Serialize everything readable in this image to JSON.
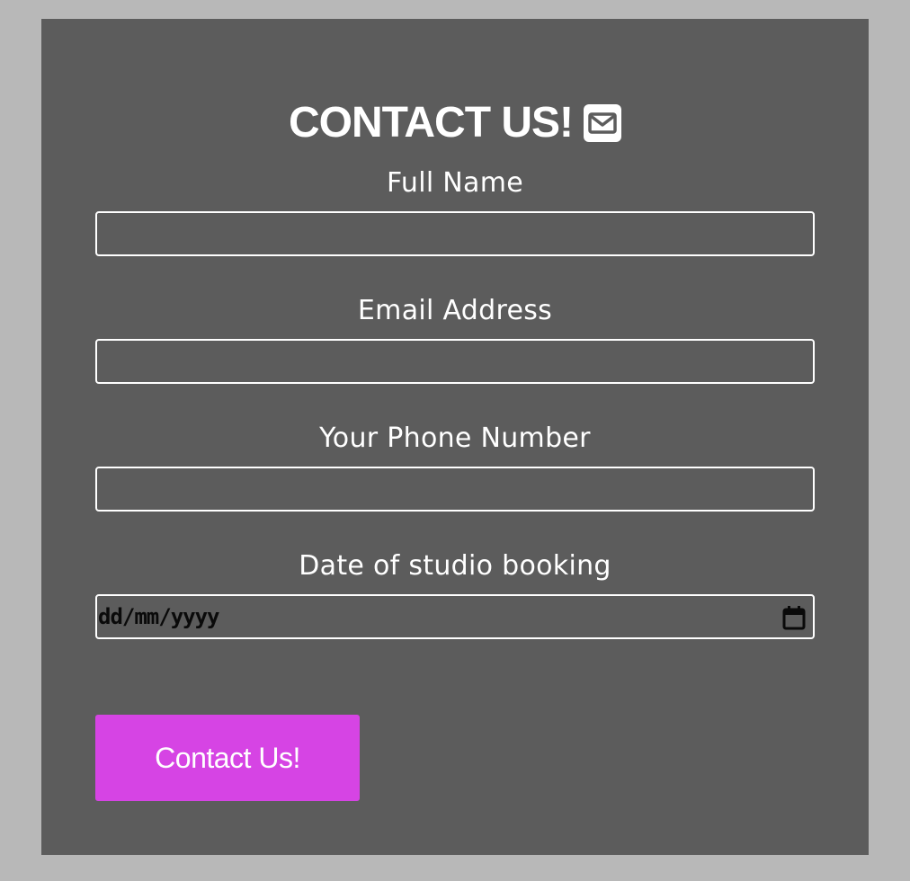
{
  "form": {
    "title": "CONTACT US!",
    "title_icon": "envelope-icon",
    "fields": [
      {
        "label": "Full Name",
        "value": "",
        "placeholder": ""
      },
      {
        "label": "Email Address",
        "value": "",
        "placeholder": ""
      },
      {
        "label": "Your Phone Number",
        "value": "",
        "placeholder": ""
      },
      {
        "label": "Date of studio booking",
        "placeholder": "dd/mm/yyyy",
        "icon": "calendar-icon"
      }
    ],
    "submit_label": "Contact Us!"
  },
  "colors": {
    "page_background": "#b8b8b8",
    "panel_background": "#5c5c5c",
    "text": "#ffffff",
    "button": "#d644e4"
  }
}
